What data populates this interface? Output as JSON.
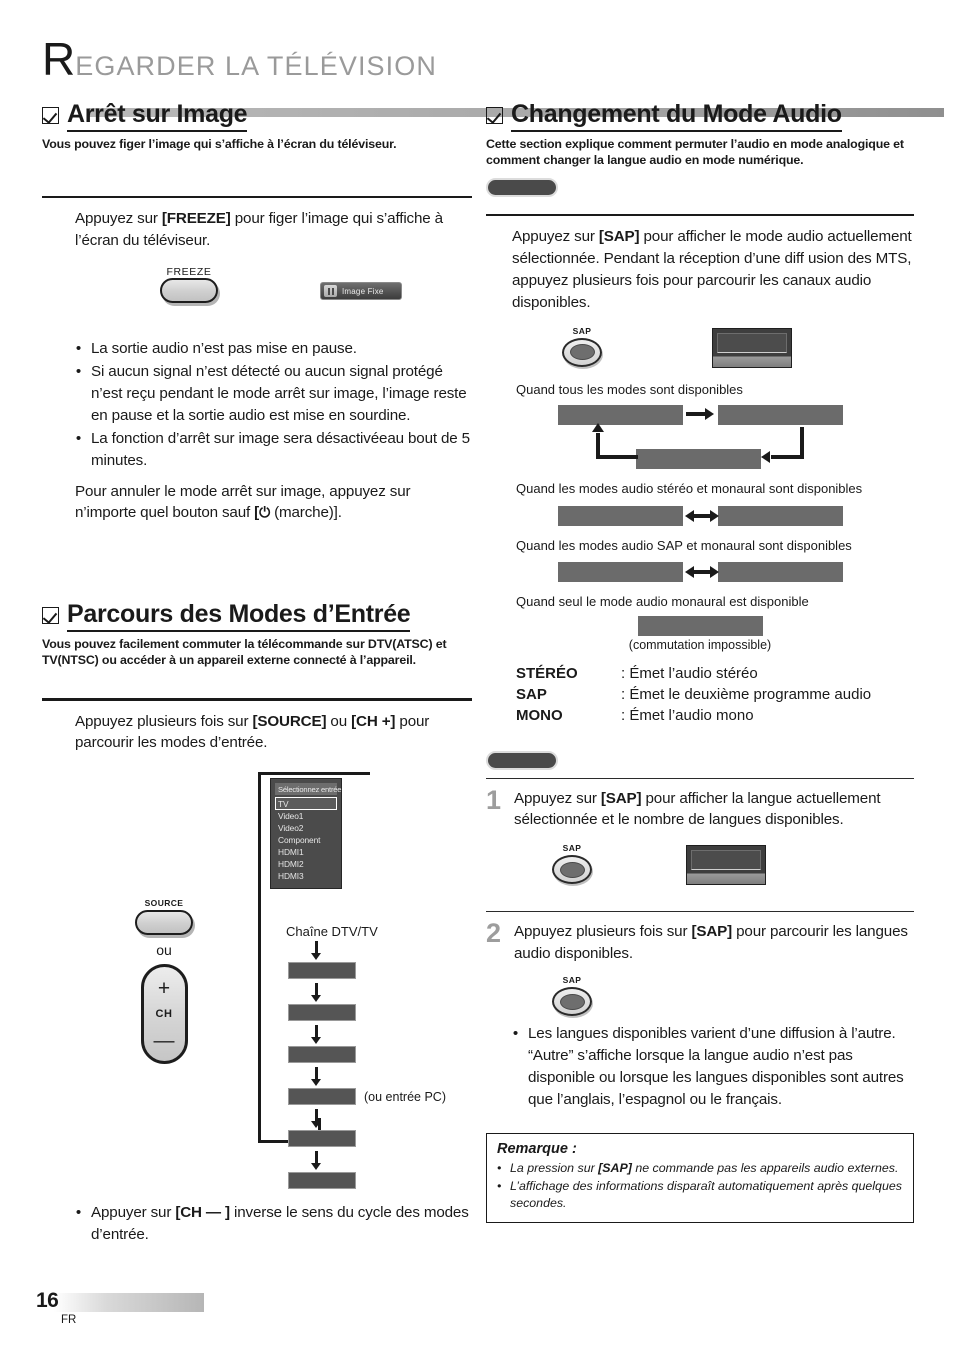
{
  "header": {
    "drop_cap": "R",
    "title_rest": "EGARDER  LA  TÉLÉVISION"
  },
  "left": {
    "freeze": {
      "title": "Arrêt sur Image",
      "subtitle": "Vous pouvez figer l’image qui s’affiche à l’écran du téléviseur.",
      "instruction_pre": "Appuyez sur ",
      "instruction_key": "[FREEZE]",
      "instruction_post": " pour figer l’image qui s’affiche à l’écran du téléviseur.",
      "button_label": "FREEZE",
      "osd_label": "Image Fixe",
      "osd_icon": "pause-icon",
      "bullets": [
        "La sortie audio n’est pas mise en pause.",
        "Si aucun signal n’est détecté ou aucun signal protégé n’est reçu pendant le mode arrêt sur image, l’image reste en pause et la sortie audio est mise en sourdine.",
        "La fonction d’arrêt sur image sera désactivéeau bout de 5 minutes."
      ],
      "cancel_pre": "Pour annuler le mode arrêt sur image, appuyez sur n’importe quel bouton sauf ",
      "cancel_key": "[",
      "cancel_power_icon": "power-icon",
      "cancel_post": " (marche)]."
    },
    "input_cycle": {
      "title": "Parcours des Modes d’Entrée",
      "subtitle": "Vous pouvez facilement commuter la télécommande sur DTV(ATSC) et TV(NTSC) ou accéder à un appareil externe connecté à l’appareil.",
      "instruction_pre": "Appuyez plusieurs fois sur ",
      "instruction_key1": "[SOURCE]",
      "instruction_mid": " ou ",
      "instruction_key2": "[CH +]",
      "instruction_post": " pour parcourir les modes d’entrée.",
      "source_menu": {
        "header": "Sélectionnez entrée",
        "items": [
          "TV",
          "Video1",
          "Video2",
          "Component",
          "HDMI1",
          "HDMI2",
          "HDMI3"
        ],
        "selected": "TV"
      },
      "source_button_label": "SOURCE",
      "or_label": "ou",
      "rocker": {
        "plus": "+",
        "ch": "CH",
        "minus": "—"
      },
      "flow_top_label": "Chaîne DTV/TV",
      "flow_pc_note": "(ou entrée PC)",
      "flow_steps": [
        "",
        "",
        "",
        "",
        "",
        ""
      ],
      "bottom_bullet_pre": "Appuyer sur ",
      "bottom_bullet_key": "[CH — ]",
      "bottom_bullet_post": " inverse le sens du cycle des modes d’entrée."
    }
  },
  "right": {
    "audio": {
      "title": "Changement du Mode Audio",
      "subtitle": "Cette section explique comment permuter l’audio en mode analogique et comment changer la langue audio en mode numérique.",
      "badge_analog": "",
      "badge_digital": "",
      "instruction_pre": "Appuyez sur ",
      "instruction_key": "[SAP]",
      "instruction_post": " pour afficher le mode audio actuellement sélectionnée. Pendant la réception d’une diff usion des MTS, appuyez plusieurs fois pour parcourir les canaux audio disponibles.",
      "sap_button_label": "SAP",
      "case_all": "Quand tous les modes sont disponibles",
      "case_stereo_mono": "Quand les modes audio stéréo et monaural sont disponibles",
      "case_sap_mono": "Quand les modes audio SAP et monaural sont disponibles",
      "case_mono_only": "Quand seul le mode audio monaural est disponible",
      "mono_note": "(commutation impossible)",
      "definitions": [
        {
          "term": "STÉRÉO",
          "desc": ": Émet l’audio stéréo"
        },
        {
          "term": "SAP",
          "desc": ": Émet le deuxième programme audio"
        },
        {
          "term": "MONO",
          "desc": ": Émet l’audio mono"
        }
      ],
      "step1": {
        "number": "1",
        "pre": "Appuyez sur ",
        "key": "[SAP]",
        "post": " pour afficher la langue actuellement sélectionnée et le nombre de langues disponibles.",
        "button_label": "SAP"
      },
      "step2": {
        "number": "2",
        "pre": "Appuyez plusieurs fois sur ",
        "key": "[SAP]",
        "post": " pour parcourir les langues audio disponibles.",
        "button_label": "SAP"
      },
      "bullet": "Les langues disponibles varient d’une diffusion à l’autre. “Autre” s’affiche lorsque la langue audio n’est pas disponible ou lorsque les langues disponibles sont autres que l’anglais, l’espagnol ou le français.",
      "remarque": {
        "title": "Remarque :",
        "items": [
          {
            "pre": "La pression sur ",
            "key": "[SAP]",
            "post": " ne commande pas les appareils audio externes."
          },
          {
            "pre": "L’affichage des informations disparaît automatiquement après quelques secondes.",
            "key": "",
            "post": ""
          }
        ]
      }
    }
  },
  "footer": {
    "page_number": "16",
    "language": "FR"
  }
}
